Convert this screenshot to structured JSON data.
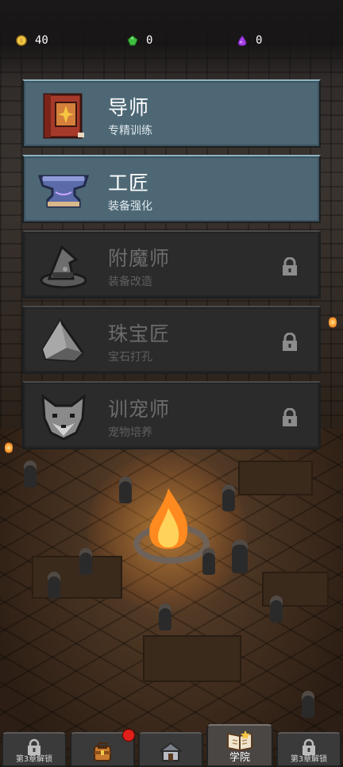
{
  "resources": [
    {
      "name": "gold",
      "value": "40",
      "color": "#f2c94c",
      "icon": "gold-coin-icon"
    },
    {
      "name": "green-gem",
      "value": "0",
      "color": "#3fbf3f",
      "icon": "green-gem-icon"
    },
    {
      "name": "purple-gem",
      "value": "0",
      "color": "#a642e8",
      "icon": "purple-gem-icon"
    }
  ],
  "menu": [
    {
      "title": "导师",
      "subtitle": "专精训练",
      "locked": false,
      "icon": "spellbook-icon"
    },
    {
      "title": "工匠",
      "subtitle": "装备强化",
      "locked": false,
      "icon": "anvil-icon"
    },
    {
      "title": "附魔师",
      "subtitle": "装备改造",
      "locked": true,
      "icon": "wizard-hat-icon"
    },
    {
      "title": "珠宝匠",
      "subtitle": "宝石打孔",
      "locked": true,
      "icon": "gem-stone-icon"
    },
    {
      "title": "训宠师",
      "subtitle": "宠物培养",
      "locked": true,
      "icon": "wolf-head-icon"
    }
  ],
  "nav": {
    "items": [
      {
        "label": "第3章解锁",
        "icon": "lock-icon",
        "active": false
      },
      {
        "label": "",
        "icon": "backpack-icon",
        "active": false,
        "badge": true
      },
      {
        "label": "",
        "icon": "shop-house-icon",
        "active": false
      },
      {
        "label": "学院",
        "icon": "academy-book-icon",
        "active": true
      },
      {
        "label": "第3章解锁",
        "icon": "lock-icon",
        "active": false
      }
    ]
  },
  "colors": {
    "card_unlocked": "#4d6775",
    "card_locked": "#2b2b2b",
    "badge": "#e0201a"
  }
}
